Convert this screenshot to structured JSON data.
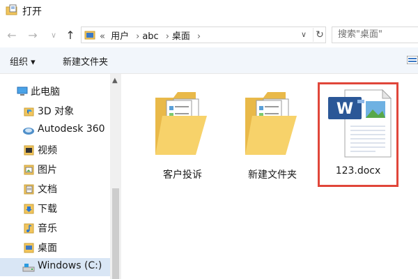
{
  "window": {
    "title": "打开"
  },
  "nav": {
    "back": "←",
    "forward": "→",
    "recent": "∨",
    "up": "↑"
  },
  "address": {
    "prefix": "«",
    "crumbs": [
      "用户",
      "abc",
      "桌面"
    ],
    "separator": "›",
    "dropdown": "∨",
    "refresh": "↻"
  },
  "search": {
    "placeholder": "搜索\"桌面\""
  },
  "toolbar": {
    "organize_label": "组织 ▾",
    "new_folder_label": "新建文件夹"
  },
  "sidebar": {
    "items": [
      {
        "label": "此电脑",
        "icon": "computer-icon"
      },
      {
        "label": "3D 对象",
        "icon": "3d-objects-icon"
      },
      {
        "label": "Autodesk 360",
        "icon": "cloud-icon"
      },
      {
        "label": "视频",
        "icon": "video-icon"
      },
      {
        "label": "图片",
        "icon": "pictures-icon"
      },
      {
        "label": "文档",
        "icon": "documents-icon"
      },
      {
        "label": "下载",
        "icon": "download-icon"
      },
      {
        "label": "音乐",
        "icon": "music-icon"
      },
      {
        "label": "桌面",
        "icon": "desktop-icon"
      },
      {
        "label": "Windows (C:)",
        "icon": "drive-icon"
      }
    ],
    "selected": "Windows (C:)"
  },
  "files": [
    {
      "name": "客户投诉",
      "type": "folder"
    },
    {
      "name": "新建文件夹",
      "type": "folder"
    },
    {
      "name": "123.docx",
      "type": "word-document"
    }
  ],
  "colors": {
    "highlight": "#e0463a",
    "folder": "#f2c55c",
    "toolbar_bg": "#f2f6fb",
    "selected_bg": "#d9e6f5",
    "word_blue": "#2b5797"
  }
}
